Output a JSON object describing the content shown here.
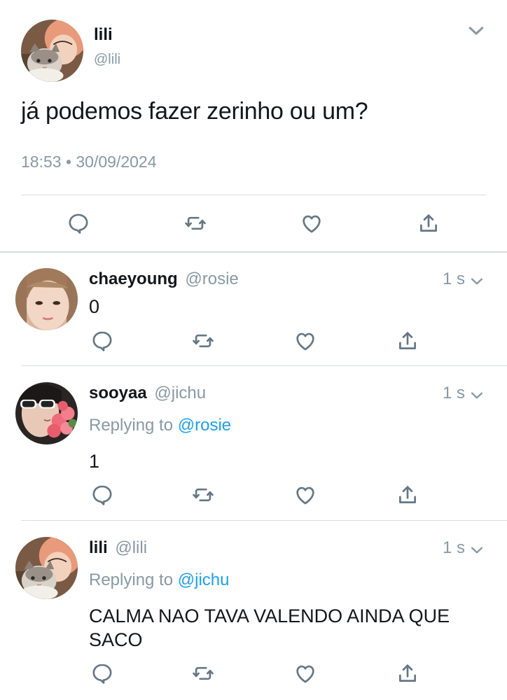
{
  "main_tweet": {
    "author_name": "lili",
    "author_handle": "@lili",
    "text": "já podemos fazer zerinho ou um?",
    "timestamp": "18:53 • 30/09/2024",
    "avatar_icon": "avatar-photo-cat-person",
    "actions": [
      "reply-icon",
      "retweet-icon",
      "like-icon",
      "share-icon"
    ]
  },
  "replies": [
    {
      "author_name": "chaeyoung",
      "author_handle": "@rosie",
      "time": "1 s",
      "replying_label": "",
      "replying_to": "",
      "text": "0",
      "avatar_icon": "avatar-photo-girl"
    },
    {
      "author_name": "sooyaa",
      "author_handle": "@jichu",
      "time": "1 s",
      "replying_label": "Replying to",
      "replying_to": "@rosie",
      "text": "1",
      "avatar_icon": "avatar-photo-sunglasses-flowers"
    },
    {
      "author_name": "lili",
      "author_handle": "@lili",
      "time": "1 s",
      "replying_label": "Replying to",
      "replying_to": "@jichu",
      "text": "CALMA NAO TAVA VALENDO AINDA QUE SACO",
      "avatar_icon": "avatar-photo-cat-person"
    }
  ],
  "colors": {
    "link": "#1da1f2",
    "secondary_text": "#8899a6",
    "icon": "#657786",
    "divider": "#d8dde2"
  }
}
